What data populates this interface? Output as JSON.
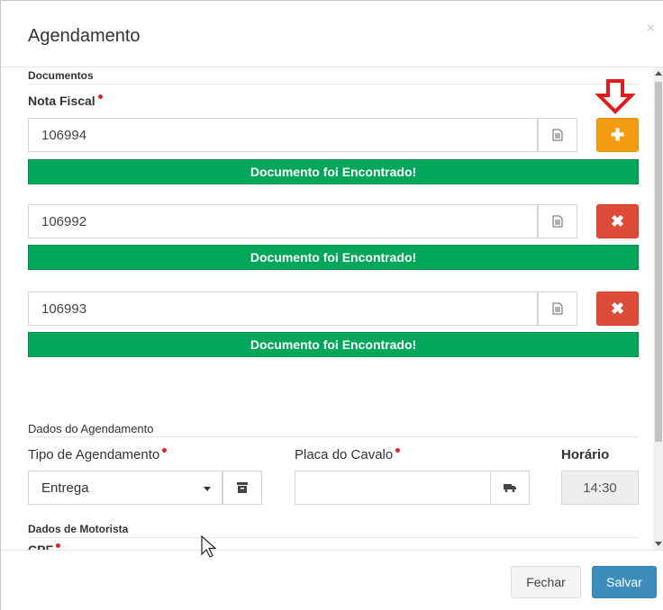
{
  "modal": {
    "title": "Agendamento",
    "close_symbol": "×"
  },
  "documentos": {
    "section_title": "Documentos",
    "nota_fiscal_label": "Nota Fiscal",
    "entries": [
      {
        "value": "106994",
        "status": "Documento foi Encontrado!",
        "action": "add",
        "action_symbol": "✚"
      },
      {
        "value": "106992",
        "status": "Documento foi Encontrado!",
        "action": "remove",
        "action_symbol": "✖"
      },
      {
        "value": "106993",
        "status": "Documento foi Encontrado!",
        "action": "remove",
        "action_symbol": "✖"
      }
    ]
  },
  "agendamento": {
    "section_title": "Dados do Agendamento",
    "tipo_label": "Tipo de Agendamento",
    "tipo_value": "Entrega",
    "placa_label": "Placa do Cavalo",
    "placa_value": "",
    "horario_label": "Horário",
    "horario_value": "14:30"
  },
  "motorista": {
    "section_title": "Dados de Motorista",
    "cpf_label": "CPF"
  },
  "footer": {
    "close_label": "Fechar",
    "save_label": "Salvar"
  },
  "colors": {
    "success": "#00a65a",
    "warning": "#f39c12",
    "danger": "#dd4b39",
    "primary": "#3c8dbc",
    "required_dot": "#d9242b"
  },
  "icons": {
    "document": "document-icon",
    "add": "plus-icon",
    "remove": "close-icon",
    "archive": "archive-icon",
    "truck": "truck-icon",
    "annotation": "red-down-arrow-icon"
  }
}
